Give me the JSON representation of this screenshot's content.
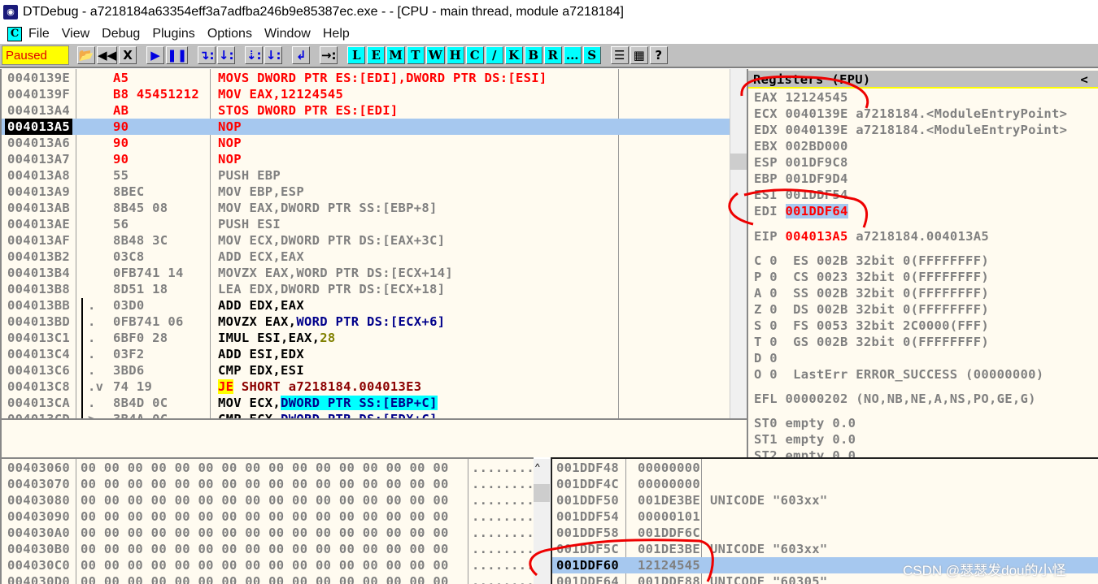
{
  "window": {
    "title": "DTDebug - a7218184a63354eff3a7adfba246b9e85387ec.exe - - [CPU - main thread, module a7218184]",
    "icon": "debugger-icon"
  },
  "menu": {
    "icon_label": "C",
    "items": [
      "File",
      "View",
      "Debug",
      "Plugins",
      "Options",
      "Window",
      "Help"
    ]
  },
  "toolbar": {
    "status": "Paused",
    "buttons": [
      {
        "name": "open-icon",
        "label": "📂"
      },
      {
        "name": "restart-icon",
        "label": "◀◀"
      },
      {
        "name": "close-icon",
        "label": "X"
      },
      {
        "gap": true
      },
      {
        "name": "run-icon",
        "label": "▶",
        "blue": true
      },
      {
        "name": "pause-icon",
        "label": "❚❚",
        "blue": true
      },
      {
        "gap": true
      },
      {
        "name": "step-into-icon",
        "label": "↴:",
        "blue": true
      },
      {
        "name": "step-over-icon",
        "label": "↓:",
        "blue": true
      },
      {
        "gap": true
      },
      {
        "name": "trace-into-icon",
        "label": "⇣:",
        "blue": true
      },
      {
        "name": "trace-over-icon",
        "label": "↓:",
        "blue": true
      },
      {
        "gap": true
      },
      {
        "name": "execute-till-return-icon",
        "label": "↲",
        "blue": true
      },
      {
        "gap": true
      },
      {
        "name": "goto-icon",
        "label": "→:"
      },
      {
        "gap": true
      },
      {
        "name": "log-window",
        "label": "L",
        "cy": true
      },
      {
        "name": "modules-window",
        "label": "E",
        "cy": true
      },
      {
        "name": "memory-window",
        "label": "M",
        "cy": true
      },
      {
        "name": "threads-window",
        "label": "T",
        "cy": true
      },
      {
        "name": "windows-window",
        "label": "W",
        "cy": true
      },
      {
        "name": "handles-window",
        "label": "H",
        "cy": true
      },
      {
        "name": "cpu-window",
        "label": "C",
        "cy": true
      },
      {
        "name": "patches-window",
        "label": "/",
        "cy": true
      },
      {
        "name": "callstack-window",
        "label": "K",
        "cy": true
      },
      {
        "name": "breakpoints-window",
        "label": "B",
        "cy": true
      },
      {
        "name": "references-window",
        "label": "R",
        "cy": true
      },
      {
        "name": "runtrace-window",
        "label": "...",
        "cy": true
      },
      {
        "name": "source-window",
        "label": "S",
        "cy": true
      },
      {
        "gap": true
      },
      {
        "name": "list-icon",
        "label": "☰"
      },
      {
        "name": "colors-icon",
        "label": "▦"
      },
      {
        "name": "help-icon",
        "label": "?"
      }
    ]
  },
  "disasm": [
    {
      "addr": "0040139E",
      "mark": "",
      "bytes": "A5",
      "bc": "red",
      "ins": [
        [
          "MOVS DWORD PTR ES:[EDI],DWORD PTR DS:[ESI]",
          "red"
        ]
      ]
    },
    {
      "addr": "0040139F",
      "mark": "",
      "bytes": "B8 45451212",
      "bc": "red",
      "ins": [
        [
          "MOV EAX,12124545",
          "red"
        ]
      ]
    },
    {
      "addr": "004013A4",
      "mark": "",
      "bytes": "AB",
      "bc": "red",
      "ins": [
        [
          "STOS DWORD PTR ES:[EDI]",
          "red"
        ]
      ]
    },
    {
      "addr": "004013A5",
      "mark": "",
      "bytes": "90",
      "bc": "red",
      "ins": [
        [
          "NOP",
          "red"
        ]
      ],
      "selected": true
    },
    {
      "addr": "004013A6",
      "mark": "",
      "bytes": "90",
      "bc": "red",
      "ins": [
        [
          "NOP",
          "red"
        ]
      ]
    },
    {
      "addr": "004013A7",
      "mark": "",
      "bytes": "90",
      "bc": "red",
      "ins": [
        [
          "NOP",
          "red"
        ]
      ]
    },
    {
      "addr": "004013A8",
      "mark": "",
      "bytes": "55",
      "bc": "gray",
      "ins": [
        [
          "PUSH EBP",
          "gray"
        ]
      ]
    },
    {
      "addr": "004013A9",
      "mark": "",
      "bytes": "8BEC",
      "bc": "gray",
      "ins": [
        [
          "MOV EBP,ESP",
          "gray"
        ]
      ]
    },
    {
      "addr": "004013AB",
      "mark": "",
      "bytes": "8B45 08",
      "bc": "gray",
      "ins": [
        [
          "MOV EAX,DWORD PTR SS:[EBP+8]",
          "gray"
        ]
      ]
    },
    {
      "addr": "004013AE",
      "mark": "",
      "bytes": "56",
      "bc": "gray",
      "ins": [
        [
          "PUSH ESI",
          "gray"
        ]
      ]
    },
    {
      "addr": "004013AF",
      "mark": "",
      "bytes": "8B48 3C",
      "bc": "gray",
      "ins": [
        [
          "MOV ECX,DWORD PTR DS:[EAX+3C]",
          "gray"
        ]
      ]
    },
    {
      "addr": "004013B2",
      "mark": "",
      "bytes": "03C8",
      "bc": "gray",
      "ins": [
        [
          "ADD ECX,EAX",
          "gray"
        ]
      ]
    },
    {
      "addr": "004013B4",
      "mark": "",
      "bytes": "0FB741 14",
      "bc": "gray",
      "ins": [
        [
          "MOVZX EAX,WORD PTR DS:[ECX+14]",
          "gray"
        ]
      ]
    },
    {
      "addr": "004013B8",
      "mark": "",
      "bytes": "8D51 18",
      "bc": "gray",
      "ins": [
        [
          "LEA EDX,DWORD PTR DS:[ECX+18]",
          "gray"
        ]
      ]
    },
    {
      "addr": "004013BB",
      "mark": ".",
      "bytes": "03D0",
      "bc": "gray",
      "ins": [
        [
          "ADD EDX,EAX",
          "blk"
        ]
      ]
    },
    {
      "addr": "004013BD",
      "mark": ".",
      "bytes": "0FB741 06",
      "bc": "gray",
      "ins": [
        [
          "MOVZX EAX,",
          "blk"
        ],
        [
          "WORD PTR DS:[ECX+6]",
          "navy"
        ]
      ]
    },
    {
      "addr": "004013C1",
      "mark": ".",
      "bytes": "6BF0 28",
      "bc": "gray",
      "ins": [
        [
          "IMUL ESI,EAX,",
          "blk"
        ],
        [
          "28",
          "olive"
        ]
      ]
    },
    {
      "addr": "004013C4",
      "mark": ".",
      "bytes": "03F2",
      "bc": "gray",
      "ins": [
        [
          "ADD ESI,EDX",
          "blk"
        ]
      ]
    },
    {
      "addr": "004013C6",
      "mark": ".",
      "bytes": "3BD6",
      "bc": "gray",
      "ins": [
        [
          "CMP EDX,ESI",
          "blk"
        ]
      ]
    },
    {
      "addr": "004013C8",
      "mark": ".v",
      "bytes": "74 19",
      "bc": "gray",
      "ins": [
        [
          "JE",
          "yel"
        ],
        [
          " SHORT a7218184.004013E3",
          "dred"
        ]
      ]
    },
    {
      "addr": "004013CA",
      "mark": ".",
      "bytes": "8B4D 0C",
      "bc": "gray",
      "ins": [
        [
          "MOV ECX,",
          "blk"
        ],
        [
          "DWORD PTR SS:[EBP+C]",
          "cyan"
        ]
      ]
    },
    {
      "addr": "004013CD",
      "mark": ">",
      "bytes": "3B4A 0C",
      "bc": "gray",
      "ins": [
        [
          "CMP ECX,",
          "blk"
        ],
        [
          "DWORD PTR DS:[EDX+C]",
          "navy"
        ]
      ]
    }
  ],
  "registers": {
    "title": "Registers (FPU)",
    "collapse": "<",
    "lines": [
      {
        "name": "EAX",
        "val": "12124545",
        "extra": ""
      },
      {
        "name": "ECX",
        "val": "0040139E",
        "extra": "a7218184.<ModuleEntryPoint>"
      },
      {
        "name": "EDX",
        "val": "0040139E",
        "extra": "a7218184.<ModuleEntryPoint>"
      },
      {
        "name": "EBX",
        "val": "002BD000",
        "extra": ""
      },
      {
        "name": "ESP",
        "val": "001DF9C8",
        "extra": ""
      },
      {
        "name": "EBP",
        "val": "001DF9D4",
        "extra": ""
      },
      {
        "name": "ESI",
        "val": "001DDF54",
        "extra": ""
      },
      {
        "name": "EDI",
        "val": "001DDF64",
        "extra": "",
        "changed": true,
        "hl": true
      },
      {
        "name": "EIP",
        "val": "004013A5",
        "extra": "a7218184.004013A5",
        "changed": true
      }
    ],
    "flags": [
      "C 0  ES 002B 32bit 0(FFFFFFFF)",
      "P 0  CS 0023 32bit 0(FFFFFFFF)",
      "A 0  SS 002B 32bit 0(FFFFFFFF)",
      "Z 0  DS 002B 32bit 0(FFFFFFFF)",
      "S 0  FS 0053 32bit 2C0000(FFF)",
      "T 0  GS 002B 32bit 0(FFFFFFFF)",
      "D 0",
      "O 0  LastErr ERROR_SUCCESS (00000000)"
    ],
    "efl": "EFL 00000202 (NO,NB,NE,A,NS,PO,GE,G)",
    "fpu": [
      "ST0 empty 0.0",
      "ST1 empty 0.0",
      "ST2 empty 0.0"
    ]
  },
  "dump": [
    {
      "addr": "00403060",
      "hex": "00 00 00 00 00 00 00 00 00 00 00 00 00 00 00 00",
      "ascii": "................"
    },
    {
      "addr": "00403070",
      "hex": "00 00 00 00 00 00 00 00 00 00 00 00 00 00 00 00",
      "ascii": "................"
    },
    {
      "addr": "00403080",
      "hex": "00 00 00 00 00 00 00 00 00 00 00 00 00 00 00 00",
      "ascii": "................"
    },
    {
      "addr": "00403090",
      "hex": "00 00 00 00 00 00 00 00 00 00 00 00 00 00 00 00",
      "ascii": "................"
    },
    {
      "addr": "004030A0",
      "hex": "00 00 00 00 00 00 00 00 00 00 00 00 00 00 00 00",
      "ascii": "................"
    },
    {
      "addr": "004030B0",
      "hex": "00 00 00 00 00 00 00 00 00 00 00 00 00 00 00 00",
      "ascii": "................"
    },
    {
      "addr": "004030C0",
      "hex": "00 00 00 00 00 00 00 00 00 00 00 00 00 00 00 00",
      "ascii": "................"
    },
    {
      "addr": "004030D0",
      "hex": "00 00 00 00 00 00 00 00 00 00 00 00 00 00 00 00",
      "ascii": "................"
    }
  ],
  "stack": [
    {
      "addr": "001DDF48",
      "val": "00000000",
      "comment": ""
    },
    {
      "addr": "001DDF4C",
      "val": "00000000",
      "comment": ""
    },
    {
      "addr": "001DDF50",
      "val": "001DE3BE",
      "comment": "UNICODE \"603xx\""
    },
    {
      "addr": "001DDF54",
      "val": "00000101",
      "comment": ""
    },
    {
      "addr": "001DDF58",
      "val": "001DDF6C",
      "comment": ""
    },
    {
      "addr": "001DDF5C",
      "val": "001DE3BE",
      "comment": "UNICODE \"603xx\""
    },
    {
      "addr": "001DDF60",
      "val": "12124545",
      "comment": "",
      "selected": true
    },
    {
      "addr": "001DDF64",
      "val": "001DDF88",
      "comment": "UNICODE \"60305\""
    }
  ],
  "watermark": "CSDN @瑟瑟发dou的小怪"
}
